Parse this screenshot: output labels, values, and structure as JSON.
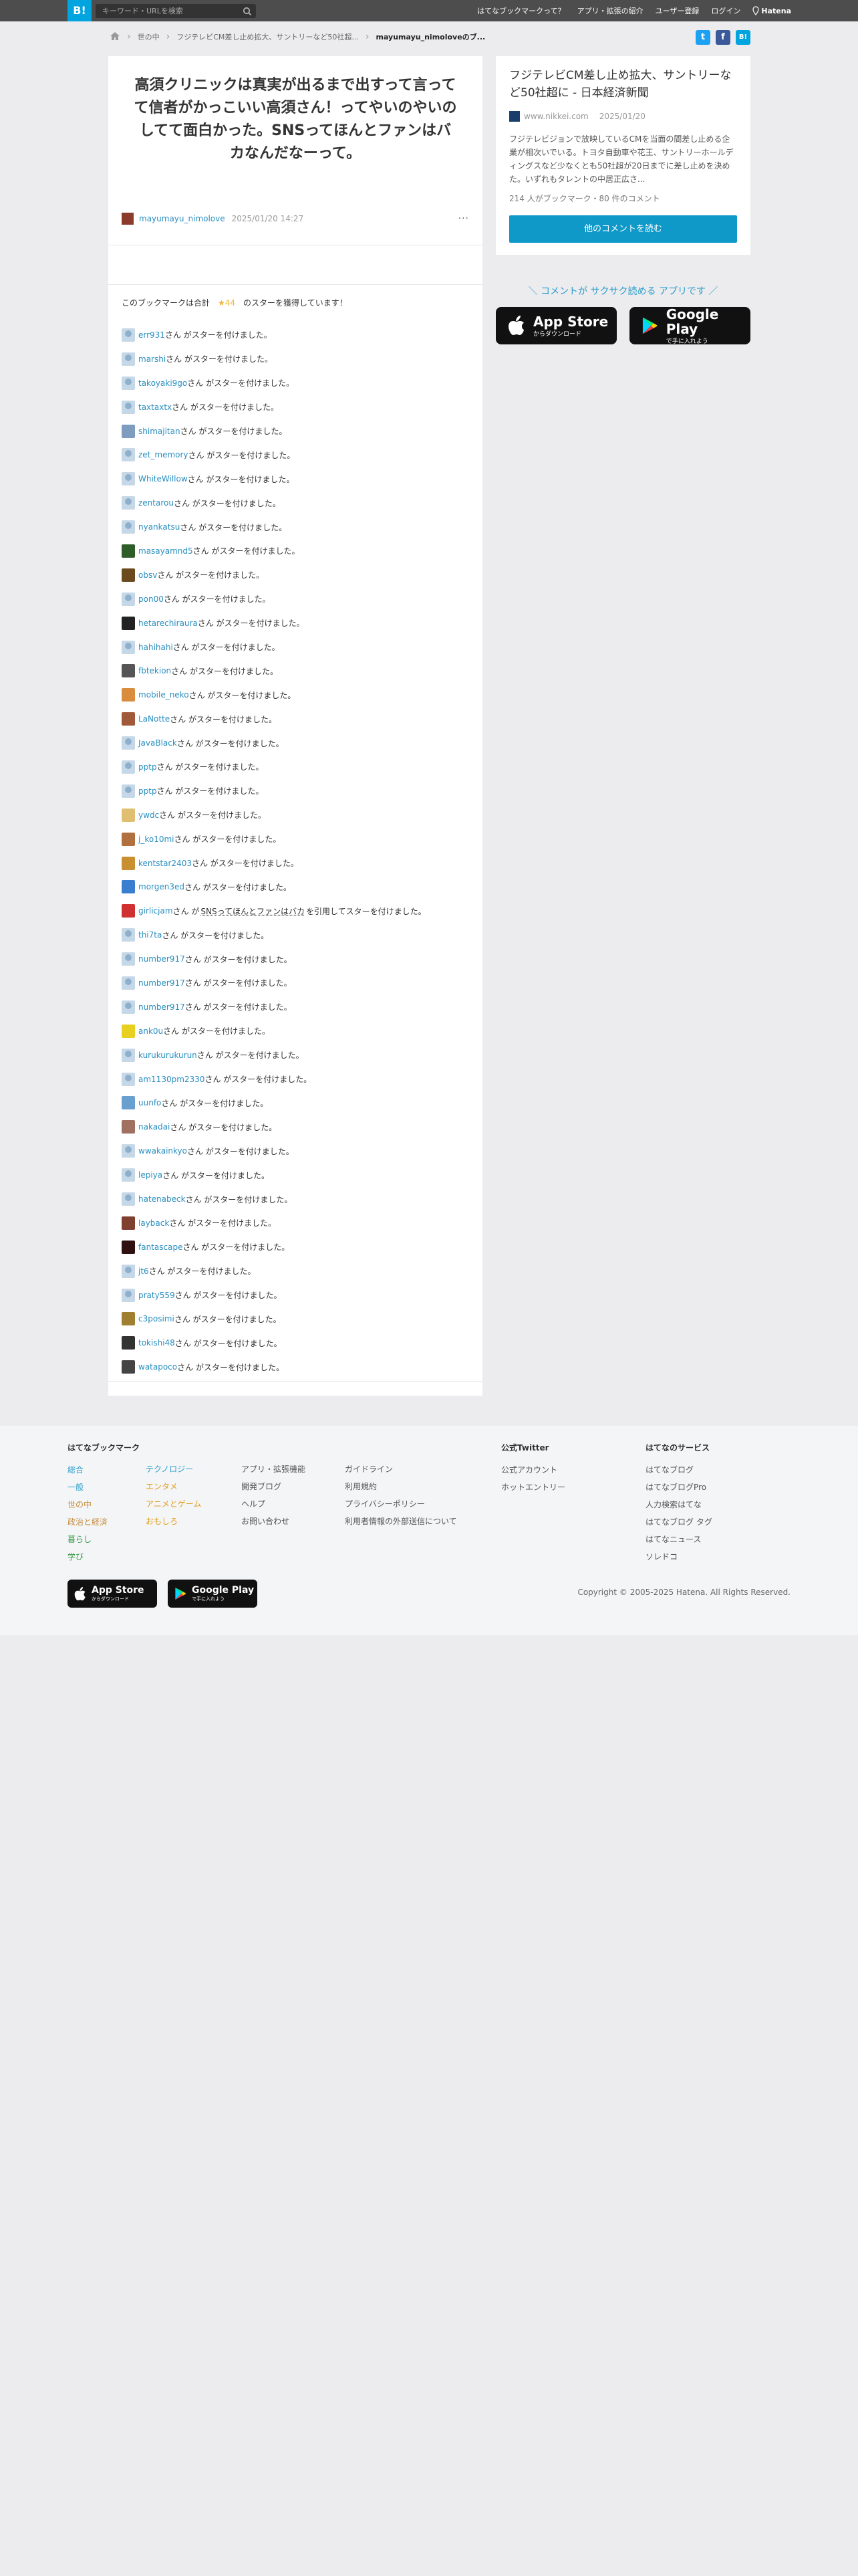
{
  "header": {
    "logo": "B!",
    "search_placeholder": "キーワード・URLを検索",
    "nav": [
      "はてなブックマークって？",
      "アプリ・拡張の紹介",
      "ユーザー登録",
      "ログイン"
    ],
    "brand": "Hatena"
  },
  "breadcrumb": {
    "items": [
      "世の中",
      "フジテレビCM差し止め拡大、サントリーなど50社超..."
    ],
    "current": "mayumayu_nimoloveのブ..."
  },
  "share": [
    "t",
    "f",
    "B!"
  ],
  "comment": {
    "text": "高須クリニックは真実が出るまで出すって言ってて信者がかっこいい高須さん！ってやいのやいのしてて面白かった。SNSってほんとファンはバカなんだなーって。",
    "author": "mayumayu_nimolove",
    "date": "2025/01/20 14:27",
    "more": "···"
  },
  "stars": {
    "summary_prefix": "このブックマークは合計",
    "summary_count": "★44",
    "summary_suffix": "のスターを獲得しています！",
    "suffix": "さん がスターを付けました。",
    "quote_prefix": "さん が",
    "quote_text": "SNSってほんとファンはバカ",
    "quote_suffix": " を引用してスターを付けました。",
    "users": [
      {
        "name": "err931",
        "color": ""
      },
      {
        "name": "marshi",
        "color": ""
      },
      {
        "name": "takoyaki9go",
        "color": ""
      },
      {
        "name": "taxtaxtx",
        "color": ""
      },
      {
        "name": "shimajitan",
        "color": "#7d9cc0"
      },
      {
        "name": "zet_memory",
        "color": ""
      },
      {
        "name": "WhiteWillow",
        "color": ""
      },
      {
        "name": "zentarou",
        "color": ""
      },
      {
        "name": "nyankatsu",
        "color": ""
      },
      {
        "name": "masayamnd5",
        "color": "#2f5d2a"
      },
      {
        "name": "obsv",
        "color": "#6b4a1e"
      },
      {
        "name": "pon00",
        "color": ""
      },
      {
        "name": "hetarechiraura",
        "color": "#222222"
      },
      {
        "name": "hahihahi",
        "color": ""
      },
      {
        "name": "fbtekion",
        "color": "#555555"
      },
      {
        "name": "mobile_neko",
        "color": "#d98c3c"
      },
      {
        "name": "LaNotte",
        "color": "#a05a3a"
      },
      {
        "name": "JavaBlack",
        "color": ""
      },
      {
        "name": "pptp",
        "color": ""
      },
      {
        "name": "pptp",
        "color": ""
      },
      {
        "name": "ywdc",
        "color": "#e0c070"
      },
      {
        "name": "j_ko10mi",
        "color": "#b07040"
      },
      {
        "name": "kentstar2403",
        "color": "#c89030"
      },
      {
        "name": "morgen3ed",
        "color": "#3a7ed0"
      },
      {
        "name": "girlicjam",
        "color": "#d03030",
        "quote": true
      },
      {
        "name": "thi7ta",
        "color": ""
      },
      {
        "name": "number917",
        "color": ""
      },
      {
        "name": "number917",
        "color": ""
      },
      {
        "name": "number917",
        "color": ""
      },
      {
        "name": "ank0u",
        "color": "#e8d020"
      },
      {
        "name": "kurukurukurun",
        "color": ""
      },
      {
        "name": "am1130pm2330",
        "color": ""
      },
      {
        "name": "uunfo",
        "color": "#6aa0d0"
      },
      {
        "name": "nakadai",
        "color": "#a07060"
      },
      {
        "name": "wwakainkyo",
        "color": ""
      },
      {
        "name": "lepiya",
        "color": ""
      },
      {
        "name": "hatenabeck",
        "color": ""
      },
      {
        "name": "layback",
        "color": "#804030"
      },
      {
        "name": "fantascape",
        "color": "#301010"
      },
      {
        "name": "jt6",
        "color": ""
      },
      {
        "name": "praty559",
        "color": ""
      },
      {
        "name": "c3posimi",
        "color": "#a08030"
      },
      {
        "name": "tokishi48",
        "color": "#333333"
      },
      {
        "name": "watapoco",
        "color": "#444444"
      }
    ]
  },
  "entry": {
    "title": "フジテレビCM差し止め拡大、サントリーなど50社超に - 日本経済新聞",
    "domain": "www.nikkei.com",
    "date": "2025/01/20",
    "description": "フジテレビジョンで放映しているCMを当面の間差し止める企業が相次いでいる。トヨタ自動車や花王、サントリーホールディングスなど少なくとも50社超が20日までに差し止めを決めた。いずれもタレントの中居正広さ...",
    "stats": "214 人がブックマーク・80 件のコメント",
    "button": "他のコメントを読む"
  },
  "app_promo": {
    "note": "＼ コメントが サクサク読める アプリです ／",
    "appstore_big": "App Store",
    "appstore_small": "からダウンロード",
    "googleplay_big": "Google Play",
    "googleplay_small": "で手に入れよう"
  },
  "footer": {
    "bookmark_heading": "はてなブックマーク",
    "cat_col1": [
      {
        "label": "総合",
        "color": "#2a9dc9"
      },
      {
        "label": "一般",
        "color": "#2a9dc9"
      },
      {
        "label": "世の中",
        "color": "#c58b3b"
      },
      {
        "label": "政治と経済",
        "color": "#c58b3b"
      },
      {
        "label": "暮らし",
        "color": "#3a9a4a"
      },
      {
        "label": "学び",
        "color": "#3a9a4a"
      }
    ],
    "cat_col2": [
      {
        "label": "テクノロジー",
        "color": "#2a9dc9"
      },
      {
        "label": "エンタメ",
        "color": "#e0a020"
      },
      {
        "label": "アニメとゲーム",
        "color": "#e0a020"
      },
      {
        "label": "おもしろ",
        "color": "#e0a020"
      }
    ],
    "col3": [
      "アプリ・拡張機能",
      "開発ブログ",
      "ヘルプ",
      "お問い合わせ"
    ],
    "col4": [
      "ガイドライン",
      "利用規約",
      "プライバシーポリシー",
      "利用者情報の外部送信について"
    ],
    "twitter_heading": "公式Twitter",
    "twitter_items": [
      "公式アカウント",
      "ホットエントリー"
    ],
    "services_heading": "はてなのサービス",
    "services_items": [
      "はてなブログ",
      "はてなブログPro",
      "人力検索はてな",
      "はてなブログ タグ",
      "はてなニュース",
      "ソレドコ"
    ],
    "copyright": "Copyright © 2005-2025 Hatena. All Rights Reserved."
  },
  "colors": {
    "topbar": "#4d4d4d",
    "brand_blue": "#00a4de",
    "link": "#2a8fc0",
    "star": "#f0b73a"
  }
}
